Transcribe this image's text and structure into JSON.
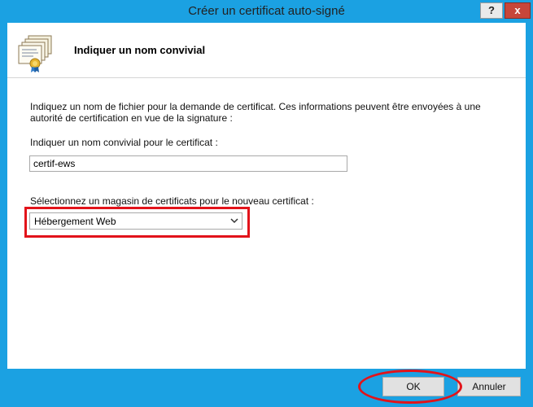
{
  "window": {
    "title": "Créer un certificat auto-signé",
    "help_label": "?",
    "close_label": "x"
  },
  "header": {
    "title": "Indiquer un nom convivial",
    "icon": "certificate-stack-icon"
  },
  "content": {
    "description": "Indiquez un nom de fichier pour la demande de certificat. Ces informations peuvent être envoyées à une autorité de certification en vue de la signature :",
    "friendly_name_label": "Indiquer un nom convivial pour le certificat :",
    "friendly_name_value": "certif-ews",
    "store_label": "Sélectionnez un magasin de certificats pour le nouveau certificat :",
    "store_selected": "Hébergement Web"
  },
  "buttons": {
    "ok": "OK",
    "cancel": "Annuler"
  },
  "colors": {
    "window_frame": "#1ba1e2",
    "close_button": "#c7463a",
    "highlight": "#e2131a"
  }
}
